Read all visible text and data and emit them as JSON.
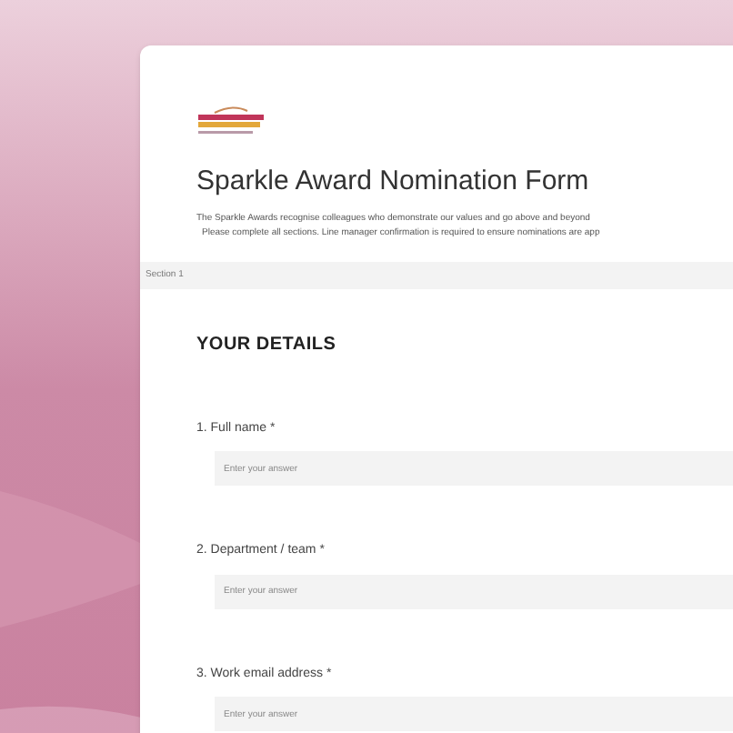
{
  "form": {
    "title": "Sparkle Award Nomination Form",
    "description": [
      "The Sparkle Awards recognise colleagues who demonstrate our values and go above and beyond",
      "Please complete all sections. Line manager confirmation is required to ensure nominations are app"
    ],
    "section_label": "Section 1",
    "section_heading": "YOUR DETAILS",
    "questions": [
      {
        "label": "1. Full name *",
        "placeholder": "Enter your answer"
      },
      {
        "label": "2. Department / team *",
        "placeholder": "Enter your answer"
      },
      {
        "label": "3. Work email address *",
        "placeholder": "Enter your answer"
      }
    ]
  }
}
